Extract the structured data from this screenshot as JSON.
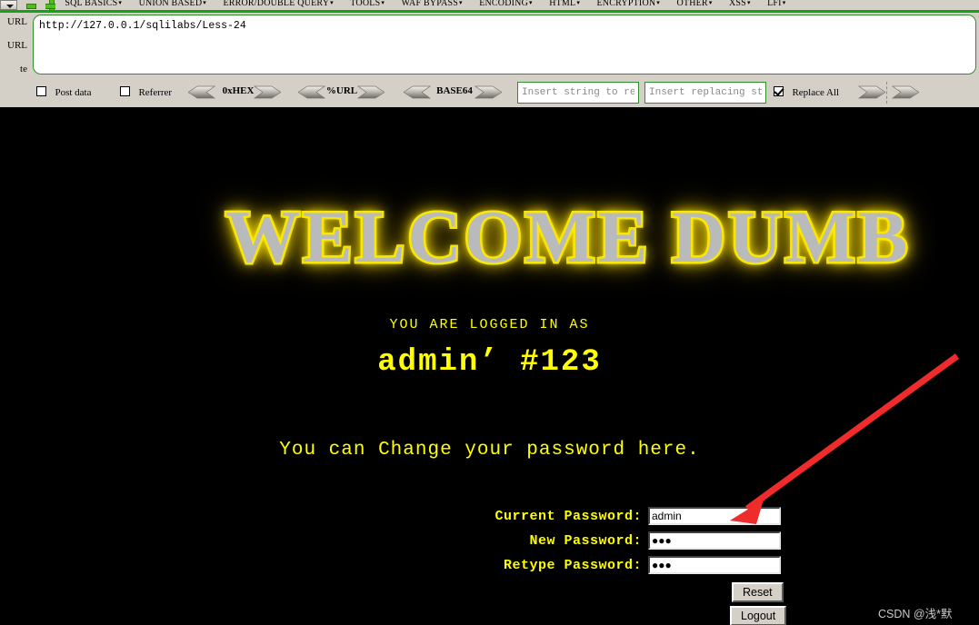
{
  "toolbar": {
    "menu_items": [
      {
        "label": "SQL BASICS",
        "caret": "▾"
      },
      {
        "label": "UNION BASED",
        "caret": "▾"
      },
      {
        "label": "ERROR/DOUBLE QUERY",
        "caret": "▾"
      },
      {
        "label": "TOOLS",
        "caret": "▾"
      },
      {
        "label": "WAF BYPASS",
        "caret": "▾"
      },
      {
        "label": "ENCODING",
        "caret": "▾"
      },
      {
        "label": "HTML",
        "caret": "▾"
      },
      {
        "label": "ENCRYPTION",
        "caret": "▾"
      },
      {
        "label": "OTHER",
        "caret": "▾"
      },
      {
        "label": "XSS",
        "caret": "▾"
      },
      {
        "label": "LFI",
        "caret": "▾"
      }
    ],
    "side_labels": {
      "load_url": "URL",
      "split_url": "URL",
      "execute": "te"
    },
    "url_value": "http://127.0.0.1/sqlilabs/Less-24",
    "post_data_label": "Post data",
    "post_data_checked": false,
    "referrer_label": "Referrer",
    "referrer_checked": false,
    "encoders": [
      {
        "label": "0xHEX"
      },
      {
        "label": "%URL"
      },
      {
        "label": "BASE64"
      }
    ],
    "replace_search_placeholder": "Insert string to replace",
    "replace_search_value": "",
    "replace_with_placeholder": "Insert replacing string",
    "replace_with_value": "",
    "replace_all_label": "Replace All",
    "replace_all_checked": true
  },
  "page": {
    "banner_text": "WELCOME DUMB",
    "logged_in_label": "YOU ARE LOGGED IN AS",
    "username": "admin’ #123",
    "change_password_text": "You can Change your password here.",
    "form": {
      "rows": [
        {
          "label": "Current Password:",
          "value": "admin",
          "type": "text"
        },
        {
          "label": "New Password:",
          "value": "●●●",
          "type": "password"
        },
        {
          "label": "Retype Password:",
          "value": "●●●",
          "type": "password"
        }
      ],
      "reset_label": "Reset",
      "logout_label": "Logout"
    },
    "watermark": "CSDN @浅*默",
    "colors": {
      "background": "#000000",
      "text_yellow": "#ffff00",
      "banner_glow": "#fff200",
      "banner_fill": "#b9babc",
      "arrow_red": "#ef2b2b",
      "toolbar_bg": "#d4d0c8",
      "toolbar_green": "#14a314"
    }
  }
}
